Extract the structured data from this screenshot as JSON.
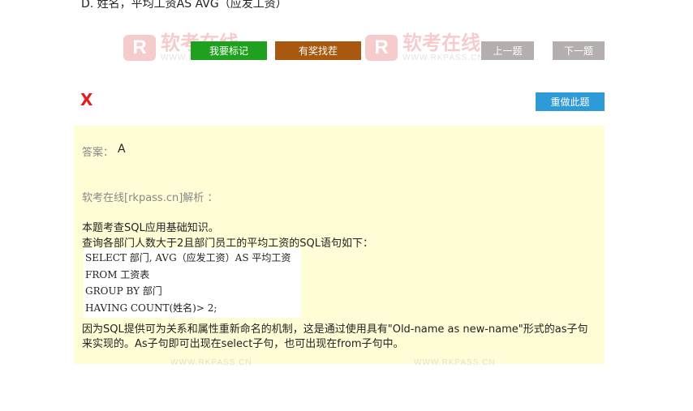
{
  "question": {
    "option_d": "D. 姓名，平均工资AS AVG（应发工资）"
  },
  "watermark": {
    "logo_letter": "R",
    "brand": "软考在线",
    "url": "WWW.RKPASS.CN"
  },
  "toolbar": {
    "mark_label": "我要标记",
    "prize_label": "有奖找茬",
    "prev_label": "上一题",
    "next_label": "下一题",
    "redo_label": "重做此题"
  },
  "result": {
    "wrong_mark": "X"
  },
  "answer": {
    "label": "答案：",
    "value": "A"
  },
  "analysis": {
    "label": "软考在线[rkpass.cn]解析 ：",
    "p1": "本题考查SQL应用基础知识。",
    "p2": "查询各部门人数大于2且部门员工的平均工资的SQL语句如下：",
    "code_lines": [
      "SELECT 部门, AVG（应发工资）AS 平均工资",
      "FROM   工资表",
      "GROUP  BY 部门",
      "HAVING COUNT(姓名)> 2;"
    ],
    "p3": "因为SQL提供可为关系和属性重新命名的机制，这是通过使用具有\"Old-name as new-name\"形式的as子句",
    "p4": "来实现的。As子句即可出现在select子句，也可出现在from子句中。"
  }
}
